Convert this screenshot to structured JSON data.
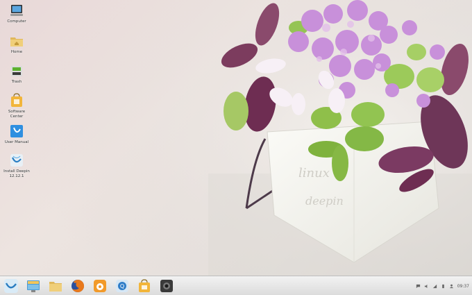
{
  "desktop": {
    "icons": [
      {
        "label": "Computer",
        "icon": "computer-icon"
      },
      {
        "label": "Home",
        "icon": "home-folder-icon"
      },
      {
        "label": "Trash",
        "icon": "trash-icon"
      },
      {
        "label": "Software Center",
        "icon": "software-center-icon"
      },
      {
        "label": "User Manual",
        "icon": "user-manual-icon"
      },
      {
        "label": "Install Deepin 12.12.1",
        "icon": "install-deepin-icon"
      }
    ]
  },
  "wallpaper": {
    "watermark_line1": "linux",
    "watermark_line2": "deepin"
  },
  "taskbar": {
    "dock": [
      {
        "name": "launcher",
        "icon": "deepin-launcher-icon"
      },
      {
        "name": "desktop",
        "icon": "show-desktop-icon"
      },
      {
        "name": "files",
        "icon": "file-manager-icon"
      },
      {
        "name": "browser",
        "icon": "firefox-icon"
      },
      {
        "name": "music",
        "icon": "music-player-icon"
      },
      {
        "name": "chat",
        "icon": "chat-icon"
      },
      {
        "name": "store",
        "icon": "software-center-icon"
      },
      {
        "name": "webcam",
        "icon": "camera-icon"
      }
    ],
    "tray": {
      "chat_icon": "chat-bubble-icon",
      "volume_icon": "volume-icon",
      "network_icon": "network-icon",
      "power_icon": "power-icon",
      "user_icon": "user-icon",
      "clock": "09:37"
    }
  },
  "colors": {
    "taskbar": "#e4e4e4",
    "flower": "#c58fd8",
    "leaf_green": "#8fc25a",
    "leaf_purple": "#7a3a5a"
  }
}
